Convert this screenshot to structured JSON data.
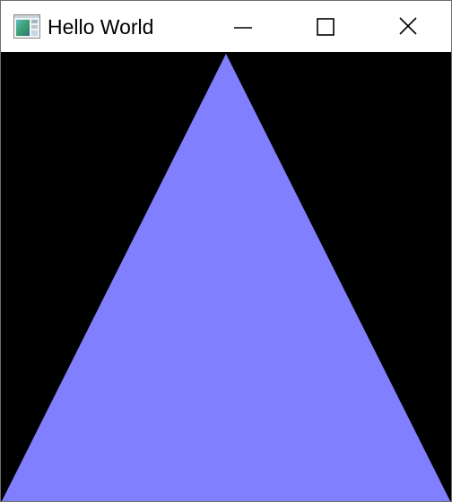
{
  "window": {
    "title": "Hello World",
    "icon": "application-window-icon"
  },
  "caption_buttons": {
    "minimize_icon": "minimize-icon",
    "maximize_icon": "maximize-icon",
    "close_icon": "close-icon"
  },
  "canvas": {
    "background_color": "#000000",
    "shape": "triangle",
    "fill_color": "#8080ff"
  }
}
